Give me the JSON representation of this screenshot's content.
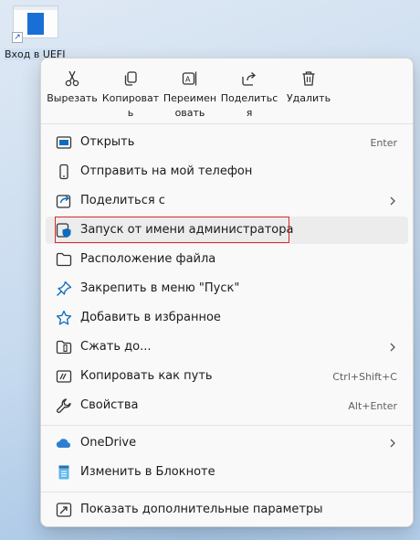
{
  "desktop": {
    "shortcut_label": "Вход в UEFI",
    "shortcut_badge": "↗"
  },
  "toolbar": [
    {
      "label": "Вырезать",
      "icon": "scissors-icon"
    },
    {
      "label": "Копировать",
      "icon": "copy-icon"
    },
    {
      "label": "Переименовать",
      "icon": "rename-icon"
    },
    {
      "label": "Поделиться",
      "icon": "share-icon"
    },
    {
      "label": "Удалить",
      "icon": "trash-icon"
    }
  ],
  "menu": {
    "items": [
      {
        "label": "Открыть",
        "shortcut": "Enter",
        "icon": "open-icon"
      },
      {
        "label": "Отправить на мой телефон",
        "icon": "phone-icon"
      },
      {
        "label": "Поделиться с",
        "icon": "share-with-icon",
        "submenu": true
      },
      {
        "label": "Запуск от имени администратора",
        "icon": "admin-shield-icon",
        "highlighted": true
      },
      {
        "label": "Расположение файла",
        "icon": "folder-icon"
      },
      {
        "label": "Закрепить в меню \"Пуск\"",
        "icon": "pin-icon"
      },
      {
        "label": "Добавить в избранное",
        "icon": "star-icon"
      },
      {
        "label": "Сжать до...",
        "icon": "archive-icon",
        "submenu": true
      },
      {
        "label": "Копировать как путь",
        "shortcut": "Ctrl+Shift+C",
        "icon": "copy-path-icon"
      },
      {
        "label": "Свойства",
        "shortcut": "Alt+Enter",
        "icon": "wrench-icon"
      }
    ],
    "group2": [
      {
        "label": "OneDrive",
        "icon": "cloud-icon",
        "submenu": true
      },
      {
        "label": "Изменить в Блокноте",
        "icon": "notepad-icon"
      }
    ],
    "group3": [
      {
        "label": "Показать дополнительные параметры",
        "icon": "more-options-icon"
      }
    ]
  },
  "colors": {
    "accent": "#0f6cbd",
    "highlight_frame": "#d8282d",
    "onedrive": "#2f7fd1"
  }
}
